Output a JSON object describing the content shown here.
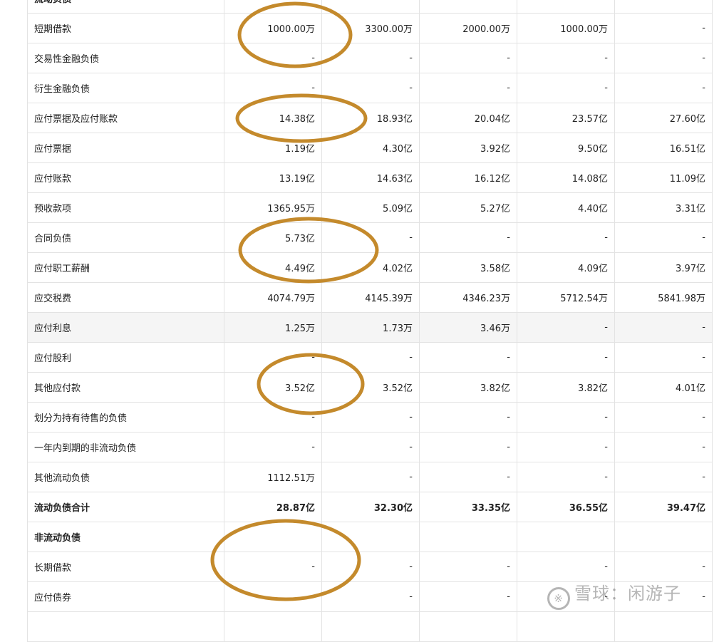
{
  "table": {
    "rows": [
      {
        "label": "流动负债",
        "values": [
          "",
          "",
          "",
          "",
          ""
        ],
        "bold": true
      },
      {
        "label": "短期借款",
        "values": [
          "1000.00万",
          "3300.00万",
          "2000.00万",
          "1000.00万",
          "-"
        ]
      },
      {
        "label": "交易性金融负债",
        "values": [
          "-",
          "-",
          "-",
          "-",
          "-"
        ]
      },
      {
        "label": "衍生金融负债",
        "values": [
          "-",
          "-",
          "-",
          "-",
          "-"
        ]
      },
      {
        "label": "应付票据及应付账款",
        "values": [
          "14.38亿",
          "18.93亿",
          "20.04亿",
          "23.57亿",
          "27.60亿"
        ]
      },
      {
        "label": "应付票据",
        "values": [
          "1.19亿",
          "4.30亿",
          "3.92亿",
          "9.50亿",
          "16.51亿"
        ]
      },
      {
        "label": "应付账款",
        "values": [
          "13.19亿",
          "14.63亿",
          "16.12亿",
          "14.08亿",
          "11.09亿"
        ]
      },
      {
        "label": "预收款项",
        "values": [
          "1365.95万",
          "5.09亿",
          "5.27亿",
          "4.40亿",
          "3.31亿"
        ]
      },
      {
        "label": "合同负债",
        "values": [
          "5.73亿",
          "-",
          "-",
          "-",
          "-"
        ]
      },
      {
        "label": "应付职工薪酬",
        "values": [
          "4.49亿",
          "4.02亿",
          "3.58亿",
          "4.09亿",
          "3.97亿"
        ]
      },
      {
        "label": "应交税费",
        "values": [
          "4074.79万",
          "4145.39万",
          "4346.23万",
          "5712.54万",
          "5841.98万"
        ]
      },
      {
        "label": "应付利息",
        "values": [
          "1.25万",
          "1.73万",
          "3.46万",
          "-",
          "-"
        ],
        "highlight": true
      },
      {
        "label": "应付股利",
        "values": [
          "-",
          "-",
          "-",
          "-",
          "-"
        ]
      },
      {
        "label": "其他应付款",
        "values": [
          "3.52亿",
          "3.52亿",
          "3.82亿",
          "3.82亿",
          "4.01亿"
        ]
      },
      {
        "label": "划分为持有待售的负债",
        "values": [
          "-",
          "-",
          "-",
          "-",
          "-"
        ]
      },
      {
        "label": "一年内到期的非流动负债",
        "values": [
          "-",
          "-",
          "-",
          "-",
          "-"
        ]
      },
      {
        "label": "其他流动负债",
        "values": [
          "1112.51万",
          "-",
          "-",
          "-",
          "-"
        ]
      },
      {
        "label": "流动负债合计",
        "values": [
          "28.87亿",
          "32.30亿",
          "33.35亿",
          "36.55亿",
          "39.47亿"
        ],
        "bold": true
      },
      {
        "label": "非流动负债",
        "values": [
          "",
          "",
          "",
          "",
          ""
        ],
        "bold": true
      },
      {
        "label": "长期借款",
        "values": [
          "-",
          "-",
          "-",
          "-",
          "-"
        ]
      },
      {
        "label": "应付债券",
        "values": [
          "-",
          "-",
          "-",
          "-",
          "-"
        ]
      },
      {
        "label": "",
        "values": [
          "",
          "",
          "",
          "",
          ""
        ]
      }
    ]
  },
  "annotations": {
    "circle_color": "#c48a2c"
  },
  "watermark": {
    "text": "雪球：闲游子",
    "logo_icon": "xueqiu-logo-icon"
  }
}
